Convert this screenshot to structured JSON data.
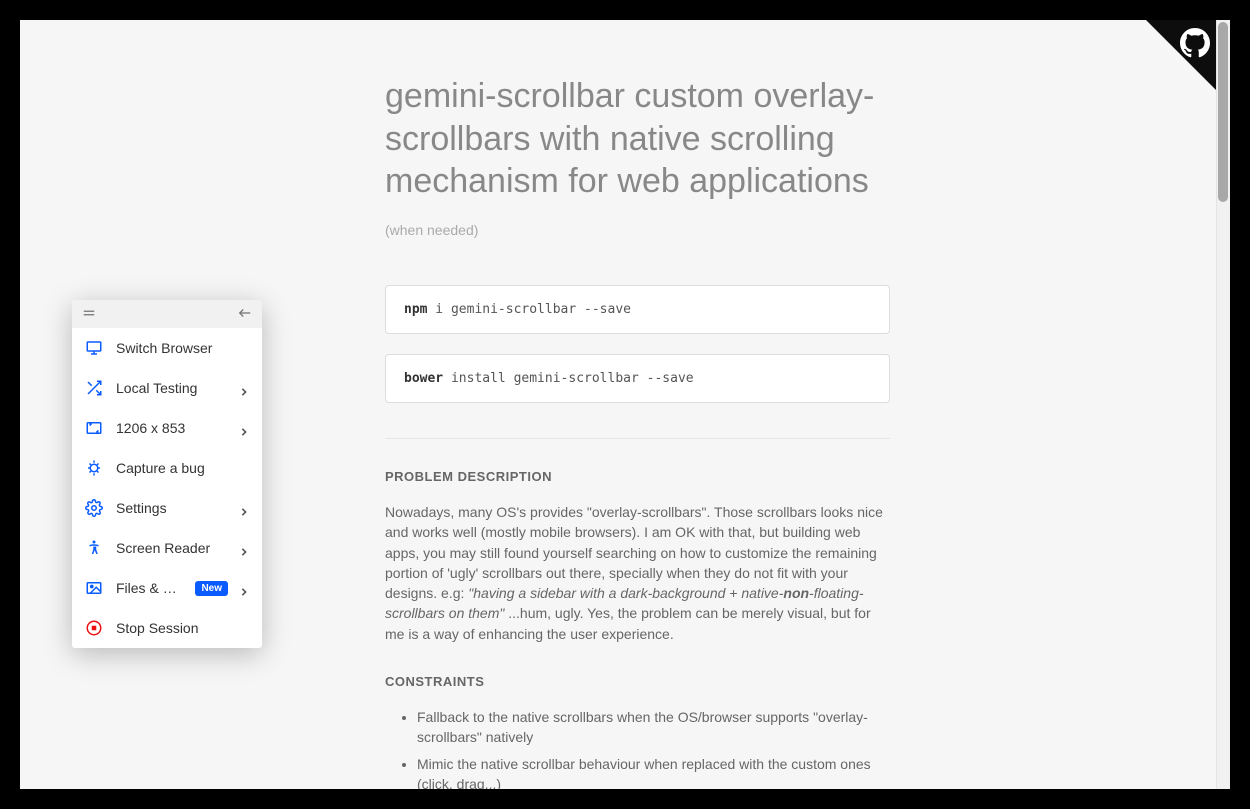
{
  "title": {
    "main": "gemini-scrollbar custom overlay-scrollbars with native scrolling mechanism for web applications",
    "sub": "(when needed)"
  },
  "install": {
    "npm_kw": "npm",
    "npm_rest": " i gemini-scrollbar --save",
    "bower_kw": "bower",
    "bower_rest": " install gemini-scrollbar --save"
  },
  "sections": {
    "problem_heading": "PROBLEM DESCRIPTION",
    "problem_p1": "Nowadays, many OS's provides \"overlay-scrollbars\". Those scrollbars looks nice and works well (mostly mobile browsers). I am OK with that, but building web apps, you may still found yourself searching on how to customize the remaining portion of 'ugly' scrollbars out there, specially when they do not fit with your designs. e.g: ",
    "problem_quote_a": "\"having a sidebar with a dark-background + native-",
    "problem_quote_bold": "non",
    "problem_quote_b": "-floating-scrollbars on them\"",
    "problem_p2": " ...hum, ugly. Yes, the problem can be merely visual, but for me is a way of enhancing the user experience.",
    "constraints_heading": "CONSTRAINTS",
    "constraints": [
      "Fallback to the native scrollbars when the OS/browser supports \"overlay-scrollbars\" natively",
      "Mimic the native scrollbar behaviour when replaced with the custom ones (click, drag...)"
    ]
  },
  "panel": {
    "items": [
      {
        "label": "Switch Browser",
        "icon": "monitor",
        "chevron": false
      },
      {
        "label": "Local Testing",
        "icon": "shuffle",
        "chevron": true
      },
      {
        "label": "1206 x 853",
        "icon": "resolution",
        "chevron": true
      },
      {
        "label": "Capture a bug",
        "icon": "bug",
        "chevron": false
      },
      {
        "label": "Settings",
        "icon": "gear",
        "chevron": true
      },
      {
        "label": "Screen Reader",
        "icon": "accessibility",
        "chevron": true
      },
      {
        "label": "Files & Media",
        "icon": "image",
        "chevron": true,
        "badge": "New"
      },
      {
        "label": "Stop Session",
        "icon": "stop",
        "chevron": false
      }
    ]
  }
}
